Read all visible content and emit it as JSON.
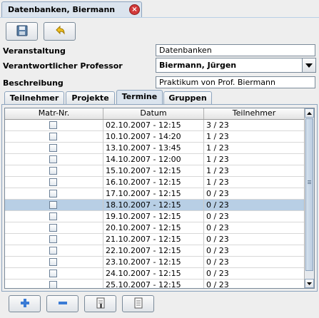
{
  "window": {
    "tab_title": "Datenbanken, Biermann",
    "close_icon": "close-icon"
  },
  "toolbar": {
    "buttons": [
      "save-icon",
      "undo-icon"
    ]
  },
  "form": {
    "veranstaltung_label": "Veranstaltung",
    "veranstaltung_value": "Datenbanken",
    "professor_label": "Verantwortlicher Professor",
    "professor_value": "Biermann, Jürgen",
    "beschreibung_label": "Beschreibung",
    "beschreibung_value": "Praktikum von Prof. Biermann"
  },
  "tabs": [
    {
      "label": "Teilnehmer",
      "active": false
    },
    {
      "label": "Projekte",
      "active": false
    },
    {
      "label": "Termine",
      "active": true
    },
    {
      "label": "Gruppen",
      "active": false
    }
  ],
  "table": {
    "columns": [
      "Matr-Nr.",
      "Datum",
      "Teilnehmer"
    ],
    "selected_row": 7,
    "rows": [
      {
        "datum": "02.10.2007 - 12:15",
        "teilnehmer": "3 / 23"
      },
      {
        "datum": "10.10.2007 - 14:20",
        "teilnehmer": "1 / 23"
      },
      {
        "datum": "13.10.2007 - 13:45",
        "teilnehmer": "1 / 23"
      },
      {
        "datum": "14.10.2007 - 12:00",
        "teilnehmer": "1 / 23"
      },
      {
        "datum": "15.10.2007 - 12:15",
        "teilnehmer": "1 / 23"
      },
      {
        "datum": "16.10.2007 - 12:15",
        "teilnehmer": "1 / 23"
      },
      {
        "datum": "17.10.2007 - 12:15",
        "teilnehmer": "0 / 23"
      },
      {
        "datum": "18.10.2007 - 12:15",
        "teilnehmer": "0 / 23"
      },
      {
        "datum": "19.10.2007 - 12:15",
        "teilnehmer": "0 / 23"
      },
      {
        "datum": "20.10.2007 - 12:15",
        "teilnehmer": "0 / 23"
      },
      {
        "datum": "21.10.2007 - 12:15",
        "teilnehmer": "0 / 23"
      },
      {
        "datum": "22.10.2007 - 12:15",
        "teilnehmer": "0 / 23"
      },
      {
        "datum": "23.10.2007 - 12:15",
        "teilnehmer": "0 / 23"
      },
      {
        "datum": "24.10.2007 - 12:15",
        "teilnehmer": "0 / 23"
      },
      {
        "datum": "25.10.2007 - 12:15",
        "teilnehmer": "0 / 23"
      }
    ]
  },
  "bottom_toolbar": {
    "buttons": [
      "add-icon",
      "remove-icon",
      "edit-icon",
      "document-icon"
    ]
  },
  "colors": {
    "selection": "#b8cfe5",
    "tab_active": "#dbe4ee",
    "close_button": "#d23a3a"
  }
}
